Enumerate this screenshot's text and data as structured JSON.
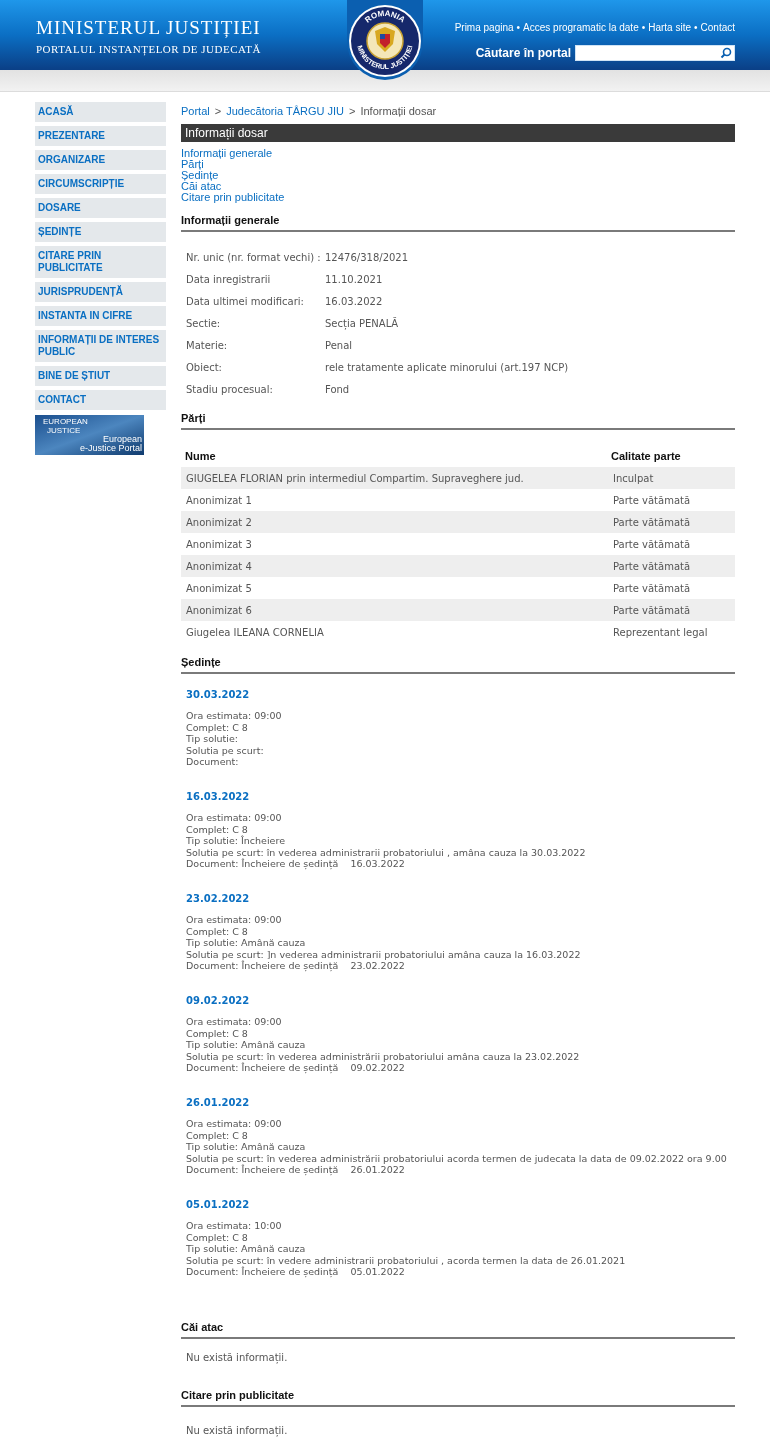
{
  "header": {
    "title": "MINISTERUL JUSTIȚIEI",
    "subtitle": "PORTALUL INSTANȚELOR DE JUDECATĂ",
    "emblem": {
      "top_text": "ROMANIA",
      "bottom_text": "MINISTERUL JUSTIȚIEI"
    },
    "top_links": [
      "Prima pagina",
      "Acces programatic la date",
      "Harta site",
      "Contact"
    ],
    "link_separator": "•",
    "search": {
      "label": "Căutare în portal"
    }
  },
  "sidebar": {
    "items": [
      "ACASĂ",
      "PREZENTARE",
      "ORGANIZARE",
      "CIRCUMSCRIPȚIE",
      "DOSARE",
      "ȘEDINȚE",
      "CITARE PRIN PUBLICITATE",
      "JURISPRUDENȚĂ",
      "INSTANTA IN CIFRE",
      "INFORMAȚII DE INTERES PUBLIC",
      "BINE DE ȘTIUT",
      "CONTACT"
    ],
    "banner": {
      "logo_top": "EUROPEAN",
      "logo_bottom": "JUSTICE",
      "title": "European",
      "subtitle": "e-Justice Portal"
    }
  },
  "breadcrumb": [
    {
      "label": "Portal",
      "link": true
    },
    {
      "label": "Judecătoria TÂRGU JIU",
      "link": true
    },
    {
      "label": "Informații dosar",
      "link": false
    }
  ],
  "breadcrumb_separator": ">",
  "page_title": "Informații dosar",
  "anchors": [
    "Informații generale",
    "Părți",
    "Ședințe",
    "Căi atac",
    "Citare prin publicitate"
  ],
  "general": {
    "heading": "Informații generale",
    "rows": [
      {
        "label": "Nr. unic (nr. format vechi) :",
        "value": "12476/318/2021"
      },
      {
        "label": "Data inregistrarii",
        "value": "11.10.2021"
      },
      {
        "label": "Data ultimei modificari:",
        "value": "16.03.2022"
      },
      {
        "label": "Sectie:",
        "value": "Secția PENALĂ"
      },
      {
        "label": "Materie:",
        "value": "Penal"
      },
      {
        "label": "Obiect:",
        "value": "rele tratamente aplicate minorului (art.197 NCP)"
      },
      {
        "label": "Stadiu procesual:",
        "value": "Fond"
      }
    ]
  },
  "parties": {
    "heading": "Părți",
    "columns": [
      "Nume",
      "Calitate parte"
    ],
    "rows": [
      [
        "GIUGELEA FLORIAN prin intermediul Compartim. Supraveghere jud.",
        "Inculpat"
      ],
      [
        "Anonimizat 1",
        "Parte vătămată"
      ],
      [
        "Anonimizat 2",
        "Parte vătămată"
      ],
      [
        "Anonimizat 3",
        "Parte vătămată"
      ],
      [
        "Anonimizat 4",
        "Parte vătămată"
      ],
      [
        "Anonimizat 5",
        "Parte vătămată"
      ],
      [
        "Anonimizat 6",
        "Parte vătămată"
      ],
      [
        "Giugelea ILEANA CORNELIA",
        "Reprezentant legal"
      ]
    ]
  },
  "sessions": {
    "heading": "Ședințe",
    "items": [
      {
        "date": "30.03.2022",
        "lines": [
          "Ora estimata: 09:00",
          "Complet: C 8",
          "Tip solutie:",
          "Solutia pe scurt:",
          "Document:"
        ]
      },
      {
        "date": "16.03.2022",
        "lines": [
          "Ora estimata: 09:00",
          "Complet: C 8",
          "Tip solutie: Încheiere",
          "Solutia pe scurt: în vederea administrarii probatoriului , amâna cauza la 30.03.2022",
          "Document: Încheiere de ședință    16.03.2022"
        ]
      },
      {
        "date": "23.02.2022",
        "lines": [
          "Ora estimata: 09:00",
          "Complet: C 8",
          "Tip solutie: Amână cauza",
          "Solutia pe scurt: ]n vederea administrarii probatoriului amâna cauza la 16.03.2022",
          "Document: Încheiere de ședință    23.02.2022"
        ]
      },
      {
        "date": "09.02.2022",
        "lines": [
          "Ora estimata: 09:00",
          "Complet: C 8",
          "Tip solutie: Amână cauza",
          "Solutia pe scurt: în vederea administrării probatoriului amâna cauza la 23.02.2022",
          "Document: Încheiere de ședință    09.02.2022"
        ]
      },
      {
        "date": "26.01.2022",
        "lines": [
          "Ora estimata: 09:00",
          "Complet: C 8",
          "Tip solutie: Amână cauza",
          "Solutia pe scurt: în vederea administrării probatoriului acorda termen de judecata la data de 09.02.2022 ora 9.00",
          "Document: Încheiere de ședință    26.01.2022"
        ]
      },
      {
        "date": "05.01.2022",
        "lines": [
          "Ora estimata: 10:00",
          "Complet: C 8",
          "Tip solutie: Amână cauza",
          "Solutia pe scurt: în vedere administrarii probatoriului , acorda termen la data de 26.01.2021",
          "Document: Încheiere de ședință    05.01.2022"
        ]
      }
    ]
  },
  "appeals": {
    "heading": "Căi atac",
    "empty_text": "Nu există informații."
  },
  "summons": {
    "heading": "Citare prin publicitate",
    "empty_text": "Nu există informații."
  }
}
